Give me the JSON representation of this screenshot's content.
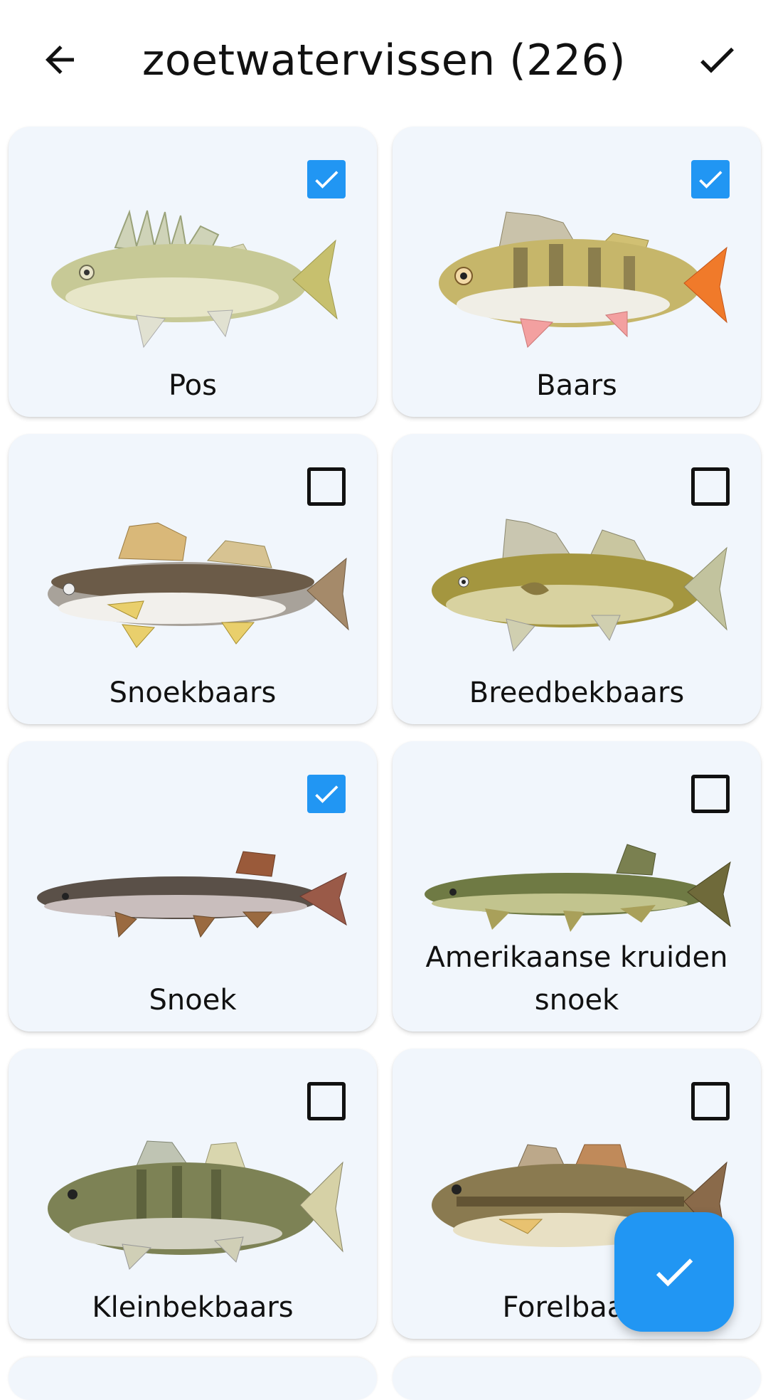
{
  "header": {
    "title": "zoetwatervissen (226)",
    "back_icon": "arrow-left-icon",
    "confirm_icon": "check-icon"
  },
  "colors": {
    "accent": "#2196f3",
    "card_bg": "#f1f6fc"
  },
  "fish": [
    {
      "name": "Pos",
      "checked": true
    },
    {
      "name": "Baars",
      "checked": true
    },
    {
      "name": "Snoekbaars",
      "checked": false
    },
    {
      "name": "Breedbekbaars",
      "checked": false
    },
    {
      "name": "Snoek",
      "checked": true
    },
    {
      "name": "Amerikaanse kruiden snoek",
      "checked": false
    },
    {
      "name": "Kleinbekbaars",
      "checked": false
    },
    {
      "name": "Forelbaars",
      "checked": false
    }
  ],
  "fab": {
    "icon": "check-icon"
  }
}
